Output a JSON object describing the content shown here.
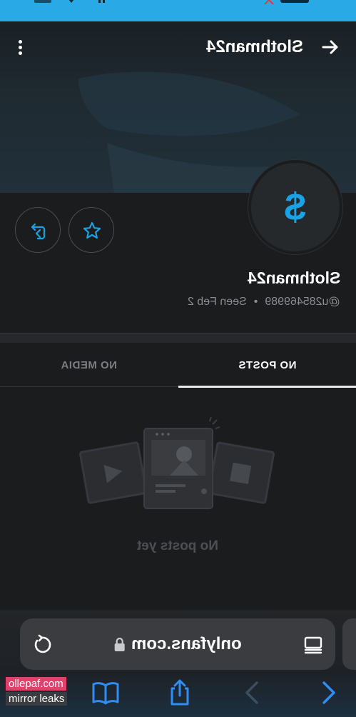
{
  "header": {
    "title": "Slothman24"
  },
  "profile": {
    "name": "Slothman24",
    "handle": "@u285469989",
    "seen": "Seen Feb 2",
    "avatar_glyph": "$",
    "accent_color": "#19a2e4"
  },
  "tabs": [
    {
      "label": "NO POSTS",
      "active": true
    },
    {
      "label": "NO MEDIA",
      "active": false
    }
  ],
  "empty_state": {
    "text": "No posts yet"
  },
  "browser": {
    "url": "onlyfans.com"
  },
  "watermark": {
    "line1": "ollepaf.com",
    "line2": "mirror leaks"
  },
  "icons": [
    "more-vertical-icon",
    "arrow-right-icon",
    "retweet-icon",
    "star-icon",
    "reload-icon",
    "lock-icon",
    "reader-icon",
    "chevron-left-icon",
    "chevron-right-icon",
    "share-icon",
    "book-icon"
  ]
}
